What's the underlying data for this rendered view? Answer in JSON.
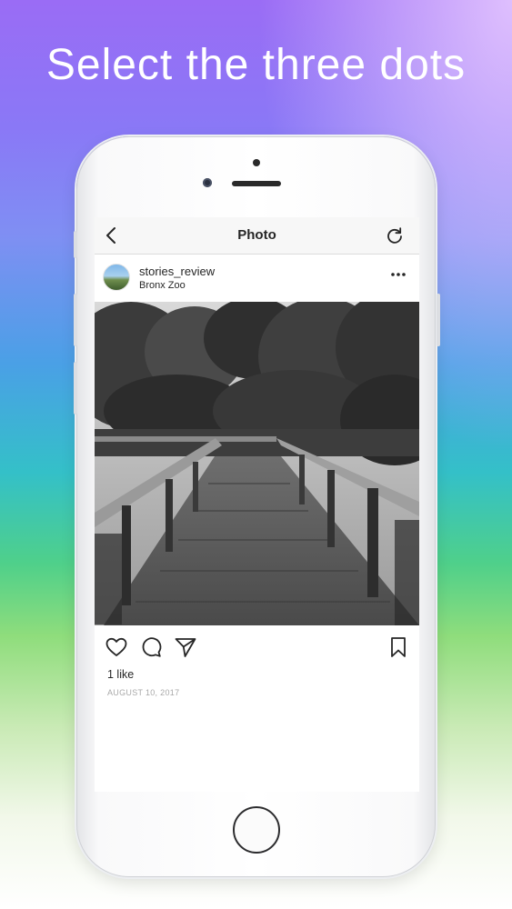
{
  "banner": {
    "headline": "Select the three dots"
  },
  "nav": {
    "title": "Photo",
    "back_icon": "chevron-left-icon",
    "refresh_icon": "refresh-icon"
  },
  "post": {
    "username": "stories_review",
    "location": "Bronx Zoo",
    "more_icon": "three-dots-icon",
    "photo_subject": "boardwalk-photo",
    "likes": "1 like",
    "date": "AUGUST 10, 2017",
    "actions": [
      "heart-icon",
      "comment-icon",
      "share-icon",
      "bookmark-icon"
    ]
  },
  "colors": {
    "text": "#262626",
    "muted": "#a8a8a8",
    "navbar": "#f7f7f7"
  }
}
